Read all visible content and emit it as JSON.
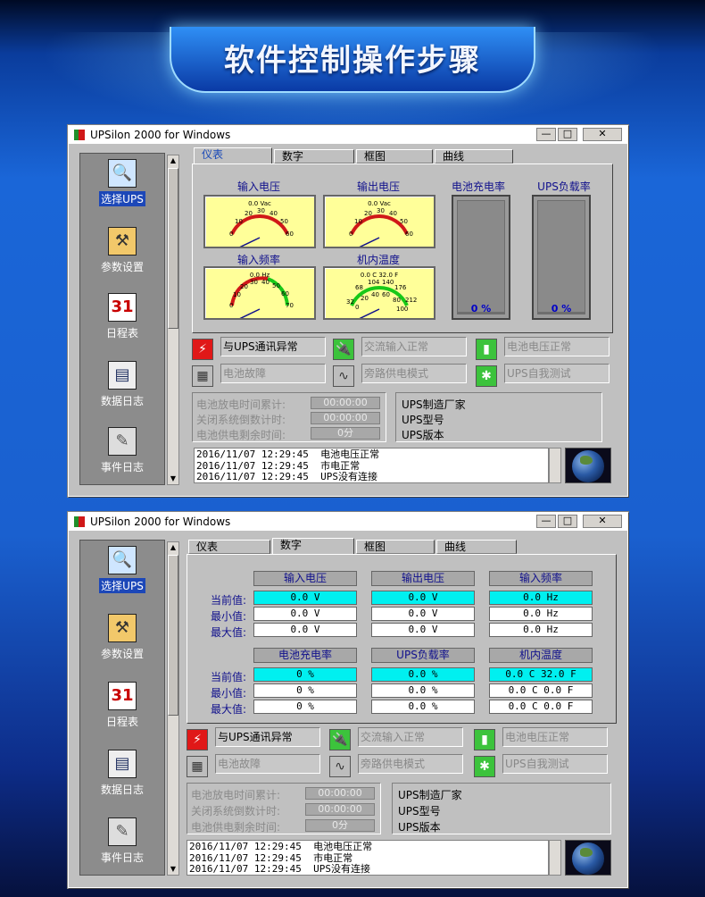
{
  "banner": {
    "title": "软件控制操作步骤"
  },
  "window": {
    "title": "UPSilon 2000 for Windows",
    "min": "—",
    "max": "□",
    "close": "✕"
  },
  "sidebar": [
    {
      "label": "选择UPS",
      "icon": "magnifier-icon",
      "glyph": "🔍"
    },
    {
      "label": "参数设置",
      "icon": "hammer-icon",
      "glyph": "⚒"
    },
    {
      "label": "日程表",
      "icon": "calendar-icon",
      "glyph": "31"
    },
    {
      "label": "数据日志",
      "icon": "document-icon",
      "glyph": "▤"
    },
    {
      "label": "事件日志",
      "icon": "pen-icon",
      "glyph": "✎"
    }
  ],
  "tabs": [
    "仪表",
    "数字",
    "框图",
    "曲线"
  ],
  "gauges": {
    "input_voltage": {
      "title": "输入电压",
      "unit": "0.0 Vac",
      "ticks": [
        "0",
        "10",
        "20",
        "30",
        "40",
        "50",
        "60"
      ]
    },
    "output_voltage": {
      "title": "输出电压",
      "unit": "0.0 Vac",
      "ticks": [
        "0",
        "10",
        "20",
        "30",
        "40",
        "50",
        "60"
      ]
    },
    "input_freq": {
      "title": "输入频率",
      "unit": "0.0 Hz",
      "ticks": [
        "0",
        "10",
        "20",
        "30",
        "40",
        "50",
        "60",
        "70"
      ]
    },
    "temperature": {
      "title": "机内温度",
      "unit": "0.0 C    32.0 F",
      "ticks_f": [
        "32",
        "68",
        "104",
        "140",
        "176",
        "212"
      ],
      "ticks_c": [
        "0",
        "20",
        "40",
        "60",
        "80",
        "100"
      ]
    },
    "battery_charge": {
      "title": "电池充电率",
      "value": "0 %"
    },
    "ups_load": {
      "title": "UPS负载率",
      "value": "0 %"
    }
  },
  "status": [
    {
      "text": "与UPS通讯异常",
      "icon": "plug-alert-icon",
      "glyph": "⚡",
      "alert": true
    },
    {
      "text": "交流输入正常",
      "icon": "ac-plug-icon",
      "glyph": "🔌",
      "alert": false
    },
    {
      "text": "电池电压正常",
      "icon": "battery-icon",
      "glyph": "▮",
      "alert": false
    },
    {
      "text": "电池故障",
      "icon": "battery-fault-icon",
      "glyph": "▦",
      "alert": false
    },
    {
      "text": "旁路供电模式",
      "icon": "sine-wave-icon",
      "glyph": "∿",
      "alert": false
    },
    {
      "text": "UPS自我测试",
      "icon": "self-test-icon",
      "glyph": "✱",
      "alert": false
    }
  ],
  "timers": [
    {
      "label": "电池放电时间累计:",
      "value": "00:00:00"
    },
    {
      "label": "关闭系统倒数计时:",
      "value": "00:00:00"
    },
    {
      "label": "电池供电剩余时间:",
      "value": "0分"
    }
  ],
  "ups_info": [
    "UPS制造厂家",
    "UPS型号",
    "UPS版本"
  ],
  "log": [
    "2016/11/07 12:29:45  电池电压正常",
    "2016/11/07 12:29:45  市电正常",
    "2016/11/07 12:29:45  UPS没有连接"
  ],
  "numeric": {
    "row_labels": [
      "当前值:",
      "最小值:",
      "最大值:"
    ],
    "groups_top": [
      {
        "header": "输入电压",
        "values": [
          "0.0 V",
          "0.0 V",
          "0.0 V"
        ]
      },
      {
        "header": "输出电压",
        "values": [
          "0.0 V",
          "0.0 V",
          "0.0 V"
        ]
      },
      {
        "header": "输入频率",
        "values": [
          "0.0 Hz",
          "0.0 Hz",
          "0.0 Hz"
        ]
      }
    ],
    "groups_bottom": [
      {
        "header": "电池充电率",
        "values": [
          "0 %",
          "0 %",
          "0 %"
        ]
      },
      {
        "header": "UPS负载率",
        "values": [
          "0.0 %",
          "0.0 %",
          "0.0 %"
        ]
      },
      {
        "header": "机内温度",
        "values": [
          "0.0 C   32.0 F",
          "0.0 C    0.0 F",
          "0.0 C    0.0 F"
        ]
      }
    ]
  },
  "colors": {
    "current_value": "#00f0f0",
    "alert_icon": "#e01818",
    "ok_icon": "#3cc33c"
  }
}
